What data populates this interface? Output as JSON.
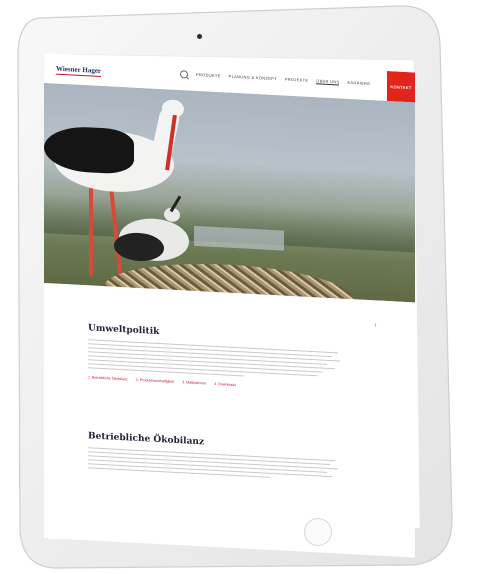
{
  "site": {
    "logo": "Wiesner Hager",
    "nav": [
      "PRODUKTE",
      "PLANUNG & KONZEPT",
      "PROJEKTE",
      "ÜBER UNS",
      "KARRIERE"
    ],
    "active_index": 3,
    "cta": "KONTAKT"
  },
  "sections": [
    {
      "heading": "Umweltpolitik",
      "links": [
        "1. Betriebliche Ökobilanz",
        "2. Produktnachhaltigkeit",
        "3. Maßnahmen",
        "4. Downloads"
      ]
    },
    {
      "heading": "Betriebliche Ökobilanz"
    }
  ],
  "colors": {
    "accent": "#e1251b",
    "heading": "#1e2233",
    "link": "#c8102e"
  },
  "icons": [
    "search-icon",
    "arrow-down-icon",
    "camera-icon",
    "home-button-icon"
  ]
}
